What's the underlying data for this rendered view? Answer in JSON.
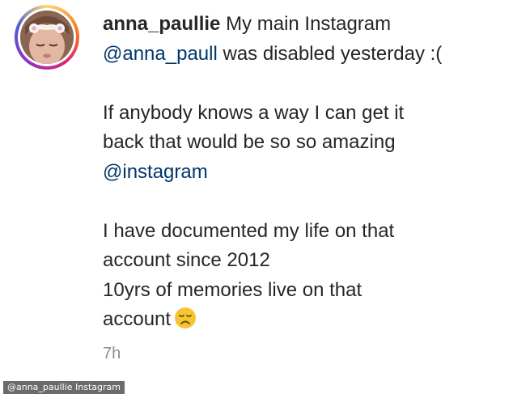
{
  "post": {
    "username": "anna_paullie",
    "caption_line1": "My main Instagram",
    "mention_account": "@anna_paull",
    "caption_line2_rest": "was disabled yesterday :(",
    "caption_line3": "If anybody knows a way I can get it",
    "caption_line4": "back that would be so so amazing",
    "mention_instagram": "@instagram",
    "caption_line6": "I have documented my life on that",
    "caption_line7": "account since 2012",
    "caption_line8": "10yrs of memories live on that",
    "caption_line9": "account",
    "emoji": "disappointed-face-emoji",
    "timestamp": "7h"
  },
  "credit": {
    "text": "@anna_paullie Instagram"
  },
  "colors": {
    "text": "#262626",
    "mention": "#00376b",
    "muted": "#8e8e8e",
    "emoji": "#f7c531"
  }
}
